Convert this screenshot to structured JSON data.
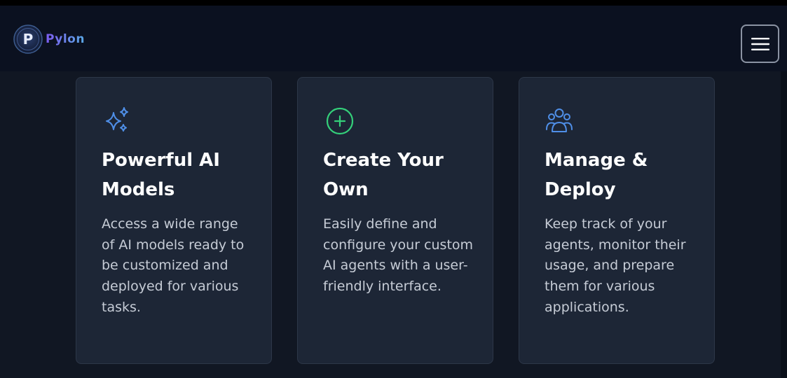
{
  "app": {
    "name": "Pylon",
    "logo_letter": "P"
  },
  "navbar": {
    "menu_icon": "hamburger-menu-icon"
  },
  "features": [
    {
      "icon": "sparkles-icon",
      "title": "Powerful AI Models",
      "description": "Access a wide range of AI models ready to be customized and deployed for various tasks."
    },
    {
      "icon": "plus-circle-icon",
      "title": "Create Your Own",
      "description": "Easily define and configure your custom AI agents with a user-friendly interface."
    },
    {
      "icon": "users-group-icon",
      "title": "Manage & Deploy",
      "description": "Keep track of your agents, monitor their usage, and prepare them for various applications."
    }
  ],
  "colors": {
    "background": "#111723",
    "navbar": "#0b1120",
    "card": "#1d2636",
    "sparkles_icon": "#4f8fe8",
    "plus_icon": "#34d07a",
    "users_icon": "#4f8fe8"
  }
}
